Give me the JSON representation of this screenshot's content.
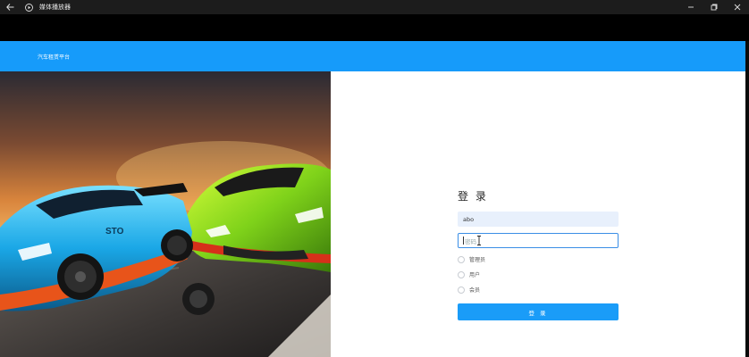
{
  "window": {
    "title": "媒体播放器",
    "icons": {
      "back": "back-arrow-icon",
      "app": "media-player-icon",
      "minimize": "minimize-icon",
      "restore": "restore-icon",
      "close": "close-icon"
    }
  },
  "header": {
    "brand": "汽车租赁平台",
    "accent_color": "#169bfa"
  },
  "login": {
    "title": "登 录",
    "username_value": "abo",
    "password_placeholder": "密码",
    "roles": [
      "管理员",
      "用户",
      "会员"
    ],
    "submit_label": "登 录",
    "button_color": "#1a9cf8"
  }
}
